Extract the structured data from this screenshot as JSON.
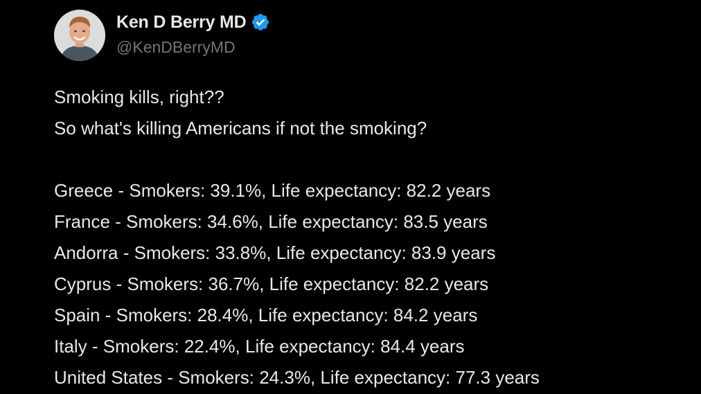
{
  "author": {
    "display_name": "Ken D Berry MD",
    "handle": "@KenDBerryMD",
    "verified": true,
    "avatar_icon": "profile-photo"
  },
  "colors": {
    "background": "#000000",
    "text": "#e7e9ea",
    "secondary_text": "#71767b",
    "verified_badge": "#1d9bf0"
  },
  "tweet": {
    "intro_lines": [
      "Smoking kills, right??",
      "So what's killing Americans if not the smoking?"
    ],
    "country_lines": [
      "Greece - Smokers: 39.1%, Life expectancy: 82.2 years",
      "France - Smokers: 34.6%, Life expectancy: 83.5 years",
      "Andorra - Smokers: 33.8%, Life expectancy: 83.9 years",
      "Cyprus - Smokers: 36.7%, Life expectancy: 82.2 years",
      "Spain - Smokers: 28.4%, Life expectancy: 84.2 years",
      "Italy - Smokers: 22.4%, Life expectancy: 84.4 years",
      "United States - Smokers: 24.3%, Life expectancy: 77.3 years"
    ]
  }
}
